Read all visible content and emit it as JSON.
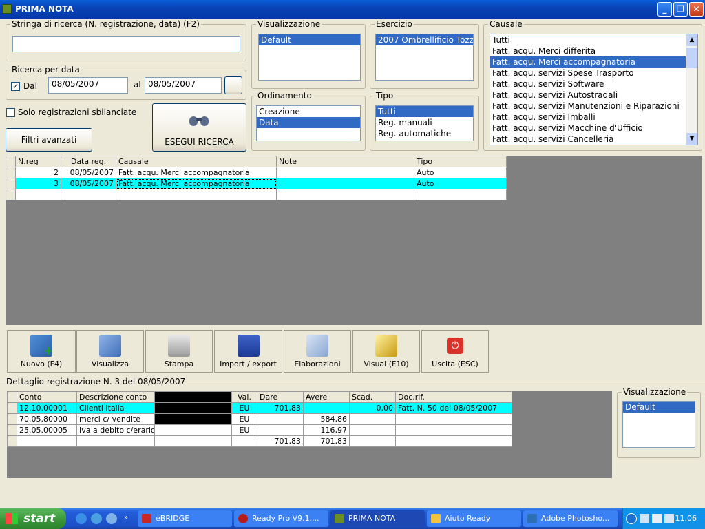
{
  "window": {
    "title": "PRIMA NOTA"
  },
  "search": {
    "label": "Stringa di ricerca (N. registrazione, data) (F2)",
    "value": ""
  },
  "date_search": {
    "label": "Ricerca per data",
    "from_label": "Dal",
    "from_checked": true,
    "from_value": "08/05/2007",
    "to_label": "al",
    "to_value": "08/05/2007"
  },
  "only_unbalanced": {
    "label": "Solo registrazioni sbilanciate",
    "checked": false
  },
  "advanced_filters_label": "Filtri avanzati",
  "run_search_label": "ESEGUI RICERCA",
  "view": {
    "label": "Visualizzazione",
    "items": [
      "Default"
    ],
    "selected": 0
  },
  "year": {
    "label": "Esercizio",
    "items": [
      "2007 Ombrellificio Tozz"
    ],
    "selected": 0
  },
  "order": {
    "label": "Ordinamento",
    "items": [
      "Creazione",
      "Data"
    ],
    "selected": 1
  },
  "type": {
    "label": "Tipo",
    "items": [
      "Tutti",
      "Reg. manuali",
      "Reg. automatiche"
    ],
    "selected": 0
  },
  "causale": {
    "label": "Causale",
    "items": [
      "Tutti",
      "Fatt. acqu. Merci differita",
      "Fatt. acqu. Merci accompagnatoria",
      "Fatt. acqu. servizi Spese Trasporto",
      "Fatt. acqu. servizi Software",
      "Fatt. acqu. servizi Autostradali",
      "Fatt. acqu. servizi Manutenzioni e Riparazioni",
      "Fatt. acqu. servizi Imballi",
      "Fatt. acqu. servizi Macchine d'Ufficio",
      "Fatt. acqu. servizi Cancelleria"
    ],
    "selected": 2
  },
  "reg_table": {
    "headers": [
      "N.reg",
      "Data reg.",
      "Causale",
      "Note",
      "Tipo"
    ],
    "rows": [
      {
        "nreg": "2",
        "data": "08/05/2007",
        "causale": "Fatt. acqu. Merci accompagnatoria",
        "note": "",
        "tipo": "Auto"
      },
      {
        "nreg": "3",
        "data": "08/05/2007",
        "causale": "Fatt. acqu. Merci accompagnatoria",
        "note": "",
        "tipo": "Auto"
      }
    ]
  },
  "toolbar": {
    "new_label": "Nuovo (F4)",
    "view_label": "Visualizza",
    "print_label": "Stampa",
    "import_label": "Import / export",
    "process_label": "Elaborazioni",
    "visual_label": "Visual (F10)",
    "exit_label": "Uscita (ESC)"
  },
  "detail": {
    "title": "Dettaglio registrazione N. 3 del 08/05/2007",
    "headers": [
      "Conto",
      "Descrizione conto",
      "",
      "Val.",
      "Dare",
      "Avere",
      "Scad.",
      "Doc.rif."
    ],
    "rows": [
      {
        "conto": "12.10.00001",
        "descr": "Clienti Italia",
        "val": "EU",
        "dare": "701,83",
        "avere": "",
        "scad": "0,00",
        "doc": "Fatt. N. 50 del 08/05/2007"
      },
      {
        "conto": "70.05.80000",
        "descr": "merci c/ vendite",
        "val": "EU",
        "dare": "",
        "avere": "584,86",
        "scad": "",
        "doc": ""
      },
      {
        "conto": "25.05.00005",
        "descr": "Iva a debito c/erario",
        "val": "EU",
        "dare": "",
        "avere": "116,97",
        "scad": "",
        "doc": ""
      }
    ],
    "totals": {
      "dare": "701,83",
      "avere": "701,83"
    }
  },
  "detail_view": {
    "label": "Visualizzazione",
    "items": [
      "Default"
    ],
    "selected": 0
  },
  "taskbar": {
    "start_label": "start",
    "tasks": [
      "eBRIDGE",
      "Ready Pro V9.1....",
      "PRIMA NOTA",
      "Aiuto Ready",
      "Adobe Photosho..."
    ],
    "clock": "11.06"
  },
  "colors": {
    "selection": "#316ac5",
    "row_highlight": "#00ffff",
    "grid_bg": "#808080"
  }
}
